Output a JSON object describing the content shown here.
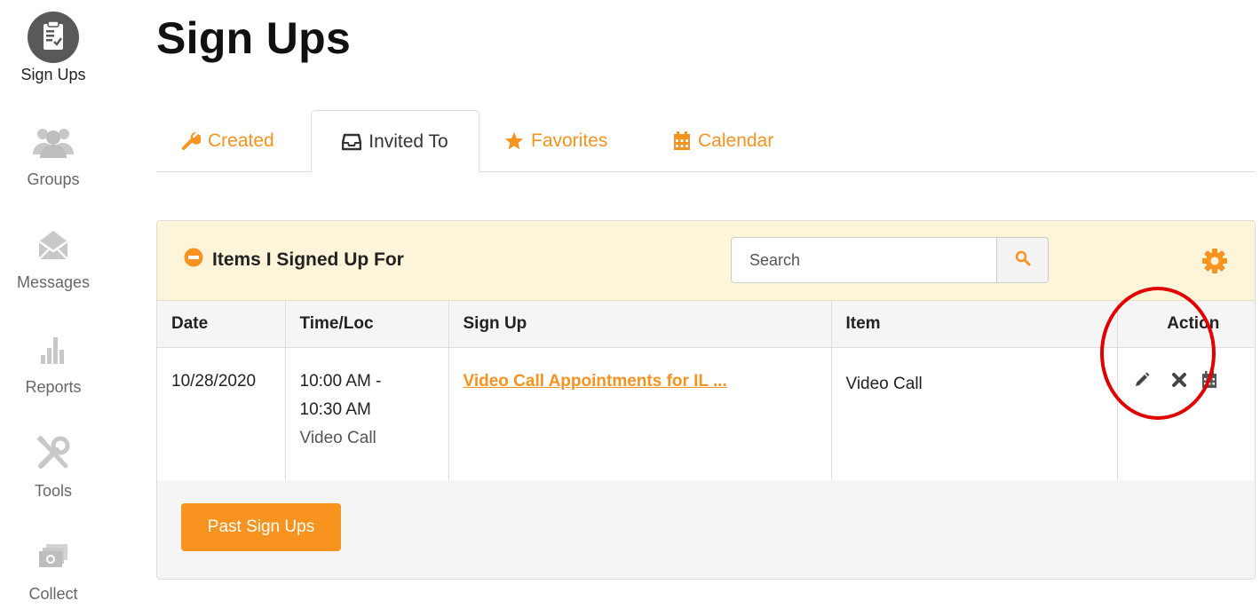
{
  "sidebar": {
    "items": [
      {
        "label": "Sign Ups",
        "icon": "clipboard-check-icon"
      },
      {
        "label": "Groups",
        "icon": "users-icon"
      },
      {
        "label": "Messages",
        "icon": "envelope-icon"
      },
      {
        "label": "Reports",
        "icon": "bar-chart-icon"
      },
      {
        "label": "Tools",
        "icon": "tools-icon"
      },
      {
        "label": "Collect",
        "icon": "money-icon"
      }
    ]
  },
  "page": {
    "title": "Sign Ups"
  },
  "tabs": [
    {
      "label": "Created",
      "icon": "wrench-icon"
    },
    {
      "label": "Invited To",
      "icon": "inbox-icon",
      "active": true
    },
    {
      "label": "Favorites",
      "icon": "star-icon"
    },
    {
      "label": "Calendar",
      "icon": "calendar-icon"
    }
  ],
  "panel": {
    "title": "Items I Signed Up For",
    "search": {
      "placeholder": "Search",
      "value": ""
    },
    "columns": [
      "Date",
      "Time/Loc",
      "Sign Up",
      "Item",
      "Action"
    ],
    "rows": [
      {
        "date": "10/28/2020",
        "time_start": "10:00 AM -",
        "time_end": "10:30 AM",
        "location": "Video Call",
        "signup": "Video Call Appointments for IL ...",
        "item": "Video Call"
      }
    ],
    "past_button": "Past Sign Ups"
  },
  "colors": {
    "accent": "#f7931e",
    "header_bg": "#fdf5d9",
    "annotation": "#e10000"
  }
}
